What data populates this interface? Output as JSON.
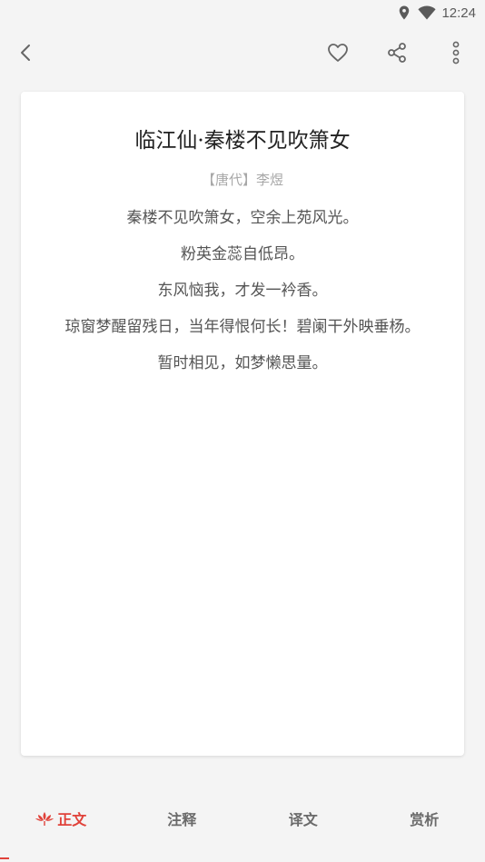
{
  "status": {
    "time": "12:24",
    "icons": [
      "location-icon",
      "wifi-icon"
    ]
  },
  "toolbar": {
    "back_icon": "back-arrow-icon",
    "favorite_icon": "heart-icon",
    "share_icon": "share-icon",
    "more_icon": "more-vertical-icon"
  },
  "poem": {
    "title": "临江仙·秦楼不见吹箫女",
    "author": "【唐代】李煜",
    "lines": [
      "秦楼不见吹箫女，空余上苑风光。",
      "粉英金蕊自低昂。",
      "东风恼我，才发一衿香。",
      "琼窗梦醒留残日，当年得恨何长！碧阑干外映垂杨。",
      "暂时相见，如梦懒思量。"
    ]
  },
  "tabs": [
    {
      "label": "正文",
      "active": true,
      "icon": "lotus-icon"
    },
    {
      "label": "注释",
      "active": false
    },
    {
      "label": "译文",
      "active": false
    },
    {
      "label": "赏析",
      "active": false
    }
  ],
  "colors": {
    "accent": "#e0423a",
    "background": "#f4f4f4",
    "card": "#ffffff"
  }
}
